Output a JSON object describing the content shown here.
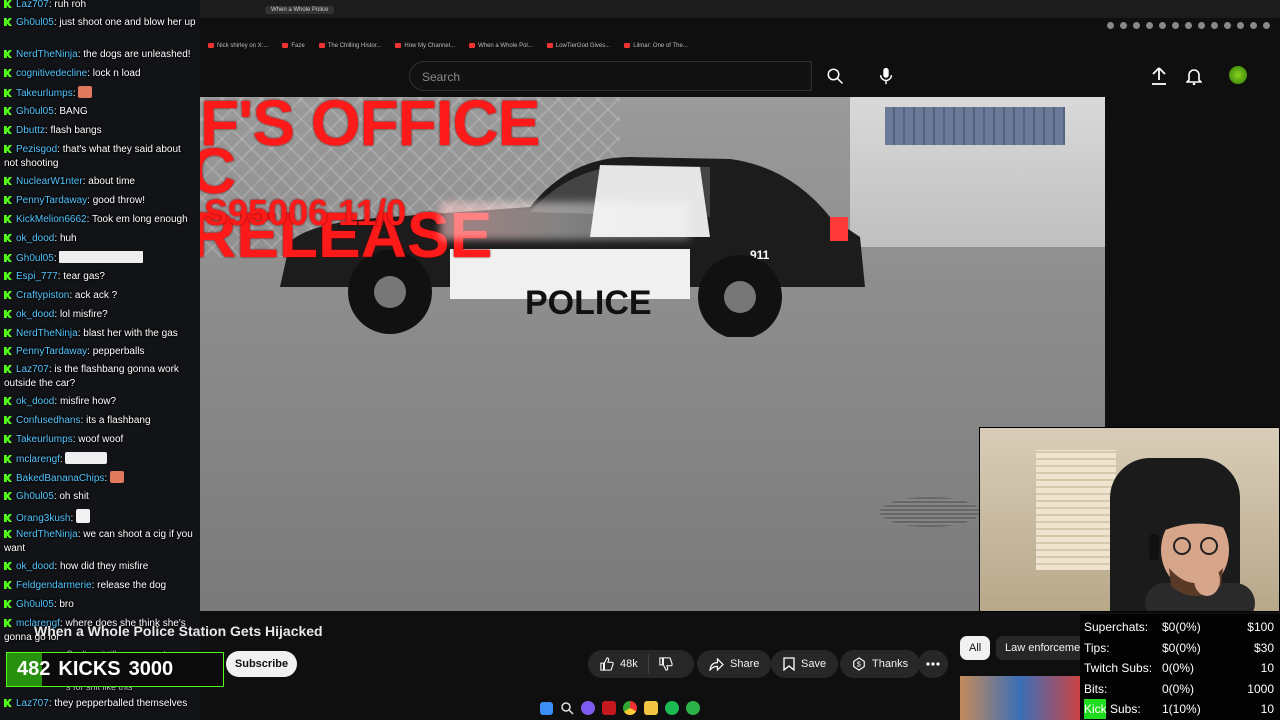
{
  "browser": {
    "tab_title": "When a Whole Police",
    "bookmarks": [
      "Nick shirley on X:...",
      "Faze",
      "The Chilling Histor...",
      "How My Channel...",
      "When a Whole Pol...",
      "LowTierGod Gives...",
      "Lilmar: One of The..."
    ]
  },
  "youtube": {
    "search_placeholder": "Search",
    "video_title": "When a Whole Police Station Gets Hijacked",
    "subscribe_label": "Subscribe",
    "likes": "48k",
    "share_label": "Share",
    "save_label": "Save",
    "thanks_label": "Thanks",
    "chips": [
      "All",
      "Law enforcemen"
    ]
  },
  "video_overlay": {
    "line1": "F'S OFFICE",
    "line2": "C RELEASE",
    "line3": "S95006 11/0"
  },
  "car_text": {
    "unit": "911",
    "door": "POLICE"
  },
  "chat": [
    {
      "user": "Laz707",
      "text": "ruh roh"
    },
    {
      "user": "Gh0ul05",
      "text": "just shoot one and blow her up"
    },
    {
      "user": "NerdTheNinja",
      "text": "the dogs are unleashed!"
    },
    {
      "user": "cognitivedecline",
      "text": "lock n load"
    },
    {
      "user": "Takeurlumps",
      "text": ""
    },
    {
      "user": "Gh0ul05",
      "text": "BANG"
    },
    {
      "user": "Dbuttz",
      "text": "flash bangs"
    },
    {
      "user": "Pezisgod",
      "text": "that's what they said about not shooting"
    },
    {
      "user": "NuclearW1nter",
      "text": "about time"
    },
    {
      "user": "PennyTardaway",
      "text": "good throw!"
    },
    {
      "user": "KickMelion6662",
      "text": "Took em long enough"
    },
    {
      "user": "ok_dood",
      "text": "huh"
    },
    {
      "user": "Gh0ul05",
      "text": ""
    },
    {
      "user": "Espi_777",
      "text": "tear gas?"
    },
    {
      "user": "Craftypiston",
      "text": "ack ack ?"
    },
    {
      "user": "ok_dood",
      "text": "lol misfire?"
    },
    {
      "user": "NerdTheNinja",
      "text": "blast her with the gas"
    },
    {
      "user": "PennyTardaway",
      "text": "pepperballs"
    },
    {
      "user": "Laz707",
      "text": "is the flashbang gonna work outside the car?"
    },
    {
      "user": "ok_dood",
      "text": "misfire how?"
    },
    {
      "user": "Confusedhans",
      "text": "its a flashbang"
    },
    {
      "user": "Takeurlumps",
      "text": "woof woof"
    },
    {
      "user": "mclarengf",
      "text": ""
    },
    {
      "user": "BakedBananaChips",
      "text": ""
    },
    {
      "user": "Gh0ul05",
      "text": "oh shit"
    },
    {
      "user": "Orang3kush",
      "text": ""
    },
    {
      "user": "NerdTheNinja",
      "text": "we can shoot a cig if you want"
    },
    {
      "user": "ok_dood",
      "text": "how did they misfire"
    },
    {
      "user": "Feldgendarmerie",
      "text": "release the dog"
    },
    {
      "user": "Gh0ul05",
      "text": "bro"
    },
    {
      "user": "mclarengf",
      "text": "where does she think she's gonna go lol"
    },
    {
      "user": "Laz707",
      "text": "they pepperballed themselves"
    }
  ],
  "chat_partial": [
    "Can't wait till racoons get",
    "ed and",
    "e ta",
    "s for shit like this"
  ],
  "kicks_goal": {
    "current": "482",
    "label": "KICKS",
    "target": "3000",
    "progress": 0.16
  },
  "stats": [
    {
      "label": "Superchats:",
      "value": "$0(0%)",
      "goal": "$100"
    },
    {
      "label": "Tips:",
      "value": "$0(0%)",
      "goal": "$30"
    },
    {
      "label": "Twitch Subs:",
      "value": "0(0%)",
      "goal": "10"
    },
    {
      "label": "Bits:",
      "value": "0(0%)",
      "goal": "1000"
    },
    {
      "label": "Kick Subs:",
      "value": "1(10%)",
      "goal": "10"
    }
  ],
  "colors": {
    "kick_green": "#53fc18",
    "overlay_red": "#ff1a1a",
    "username_blue": "#53c5ff"
  }
}
